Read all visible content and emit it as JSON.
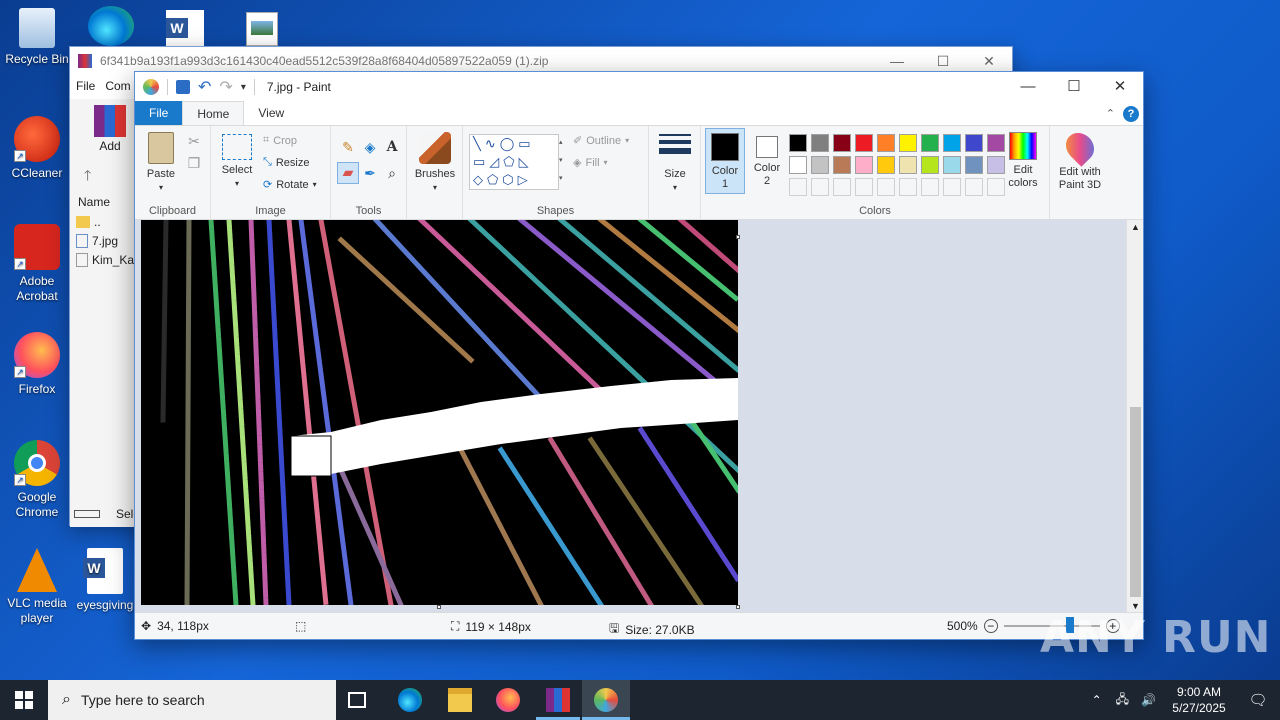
{
  "desktop": {
    "icons": [
      {
        "label": "Recycle Bin"
      },
      {
        "label": "CCleaner"
      },
      {
        "label": "Adobe Acrobat"
      },
      {
        "label": "Firefox"
      },
      {
        "label": "Google Chrome"
      },
      {
        "label": "VLC media player"
      },
      {
        "label": "eyesgiving"
      }
    ]
  },
  "winrar": {
    "title": "6f341b9a193f1a993d3c161430c40ead5512c539f28a8f68404d05897522a059 (1).zip",
    "menu": [
      "File",
      "Com"
    ],
    "add_label": "Add",
    "list_header": "Name",
    "files": [
      "..",
      "7.jpg",
      "Kim_Kar"
    ],
    "status": "Sele"
  },
  "paint": {
    "caption": "7.jpg - Paint",
    "tabs": {
      "file": "File",
      "home": "Home",
      "view": "View"
    },
    "help": "?",
    "clipboard": {
      "paste": "Paste",
      "label": "Clipboard"
    },
    "image": {
      "select": "Select",
      "crop": "Crop",
      "resize": "Resize",
      "rotate": "Rotate",
      "label": "Image"
    },
    "tools": {
      "label": "Tools"
    },
    "brushes": {
      "label": "Brushes"
    },
    "shapes": {
      "outline": "Outline",
      "fill": "Fill",
      "label": "Shapes"
    },
    "size": {
      "label": "Size"
    },
    "color1": {
      "label": "Color",
      "num": "1",
      "value": "#000000"
    },
    "color2": {
      "label": "Color",
      "num": "2",
      "value": "#ffffff"
    },
    "colors_label": "Colors",
    "edit_colors": {
      "l1": "Edit",
      "l2": "colors"
    },
    "paint3d": {
      "l1": "Edit with",
      "l2": "Paint 3D"
    },
    "palette_row1": [
      "#000000",
      "#7f7f7f",
      "#880015",
      "#ed1c24",
      "#ff7f27",
      "#fff200",
      "#22b14c",
      "#00a2e8",
      "#3f48cc",
      "#a349a4"
    ],
    "palette_row2": [
      "#ffffff",
      "#c3c3c3",
      "#b97a57",
      "#ffaec9",
      "#ffc90e",
      "#efe4b0",
      "#b5e61d",
      "#99d9ea",
      "#7092be",
      "#c8bfe7"
    ],
    "status": {
      "cursor": "34, 118px",
      "selection_size": "119 × 148px",
      "file_size": "Size: 27.0KB",
      "zoom": "500%"
    }
  },
  "taskbar": {
    "search_placeholder": "Type here to search",
    "time": "9:00 AM",
    "date": "5/27/2025"
  },
  "watermark": "ANY RUN"
}
